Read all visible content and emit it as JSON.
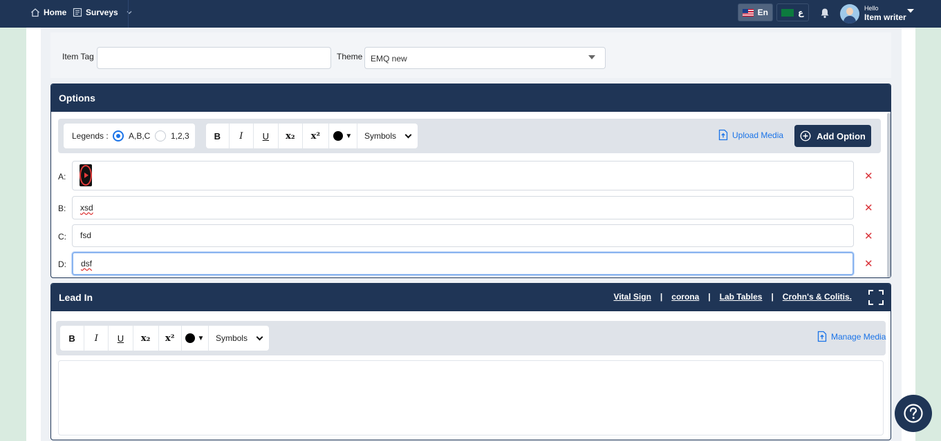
{
  "nav": {
    "home_label": "Home",
    "surveys_label": "Surveys",
    "lang_en_label": "En",
    "lang_ar_label": "ع",
    "user_greeting": "Hello",
    "user_name": "Item writer"
  },
  "item_tag": {
    "label": "Item Tag",
    "value": ""
  },
  "theme": {
    "label": "Theme",
    "selected": "EMQ new"
  },
  "options_section": {
    "title": "Options",
    "legends_label": "Legends :",
    "legend_choices": [
      "A,B,C",
      "1,2,3"
    ],
    "legend_selected": "A,B,C",
    "toolbar": {
      "bold": "B",
      "italic": "I",
      "underline": "U",
      "subscript": "x₂",
      "superscript": "x²",
      "symbols": "Symbols"
    },
    "upload_media": "Upload Media",
    "add_option": "Add Option",
    "options": [
      {
        "letter": "A:",
        "text": "",
        "has_media": true
      },
      {
        "letter": "B:",
        "text": "xsd"
      },
      {
        "letter": "C:",
        "text": "fsd"
      },
      {
        "letter": "D:",
        "text": "dsf"
      }
    ],
    "remove_glyph": "✕"
  },
  "leadin_section": {
    "title": "Lead In",
    "links": [
      "Vital Sign",
      "corona",
      "Lab Tables",
      "Crohn's & Colitis."
    ],
    "separator": "|",
    "toolbar": {
      "bold": "B",
      "italic": "I",
      "underline": "U",
      "subscript": "x₂",
      "superscript": "x²",
      "symbols": "Symbols"
    },
    "manage_media": "Manage Media",
    "editor_value": ""
  },
  "colors": {
    "navy": "#1f3556",
    "accent_blue": "#1a73e8",
    "remove_red": "#d9343a",
    "side_green": "#d9ebe0"
  }
}
